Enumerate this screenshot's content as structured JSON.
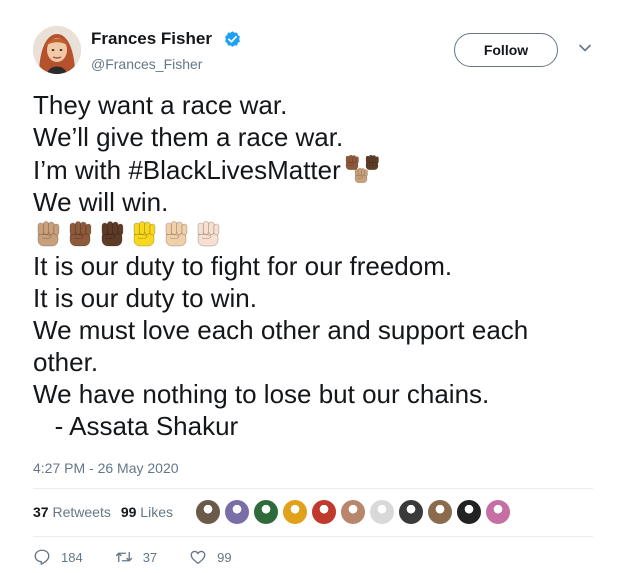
{
  "author": {
    "name": "Frances Fisher",
    "handle": "@Frances_Fisher",
    "verified_icon": "verified-badge-icon"
  },
  "follow_label": "Follow",
  "tweet": {
    "lines": [
      "They want a race war.",
      "We’ll give them a race war.",
      "I’m with ",
      "#BlackLivesMatter",
      "We will win.",
      "It is our duty to fight for our freedom.",
      "It is our duty to win.",
      "We must love each other and support each",
      "other.",
      "We have nothing to lose but our chains.",
      "   - Assata Shakur"
    ],
    "fist_colors": [
      "#c9a07a",
      "#8d5a3b",
      "#5e3b26",
      "#f9d71c",
      "#f1cfa8",
      "#f7e0cf"
    ],
    "hashtag_fist_colors": [
      "#8d5a3b",
      "#5e3b26",
      "#c9a07a"
    ]
  },
  "timestamp": "4:27 PM - 26 May 2020",
  "stats": {
    "retweets_count": "37",
    "retweets_label": "Retweets",
    "likes_count": "99",
    "likes_label": "Likes"
  },
  "liker_colors": [
    "#6b5a4a",
    "#7b6ea8",
    "#2f6b3a",
    "#e2a11a",
    "#c0392b",
    "#b8866b",
    "#d9d9d9",
    "#3a3a3a",
    "#8b6a4d",
    "#222222",
    "#c56fa3"
  ],
  "actions": {
    "reply_count": "184",
    "retweet_count": "37",
    "like_count": "99"
  }
}
